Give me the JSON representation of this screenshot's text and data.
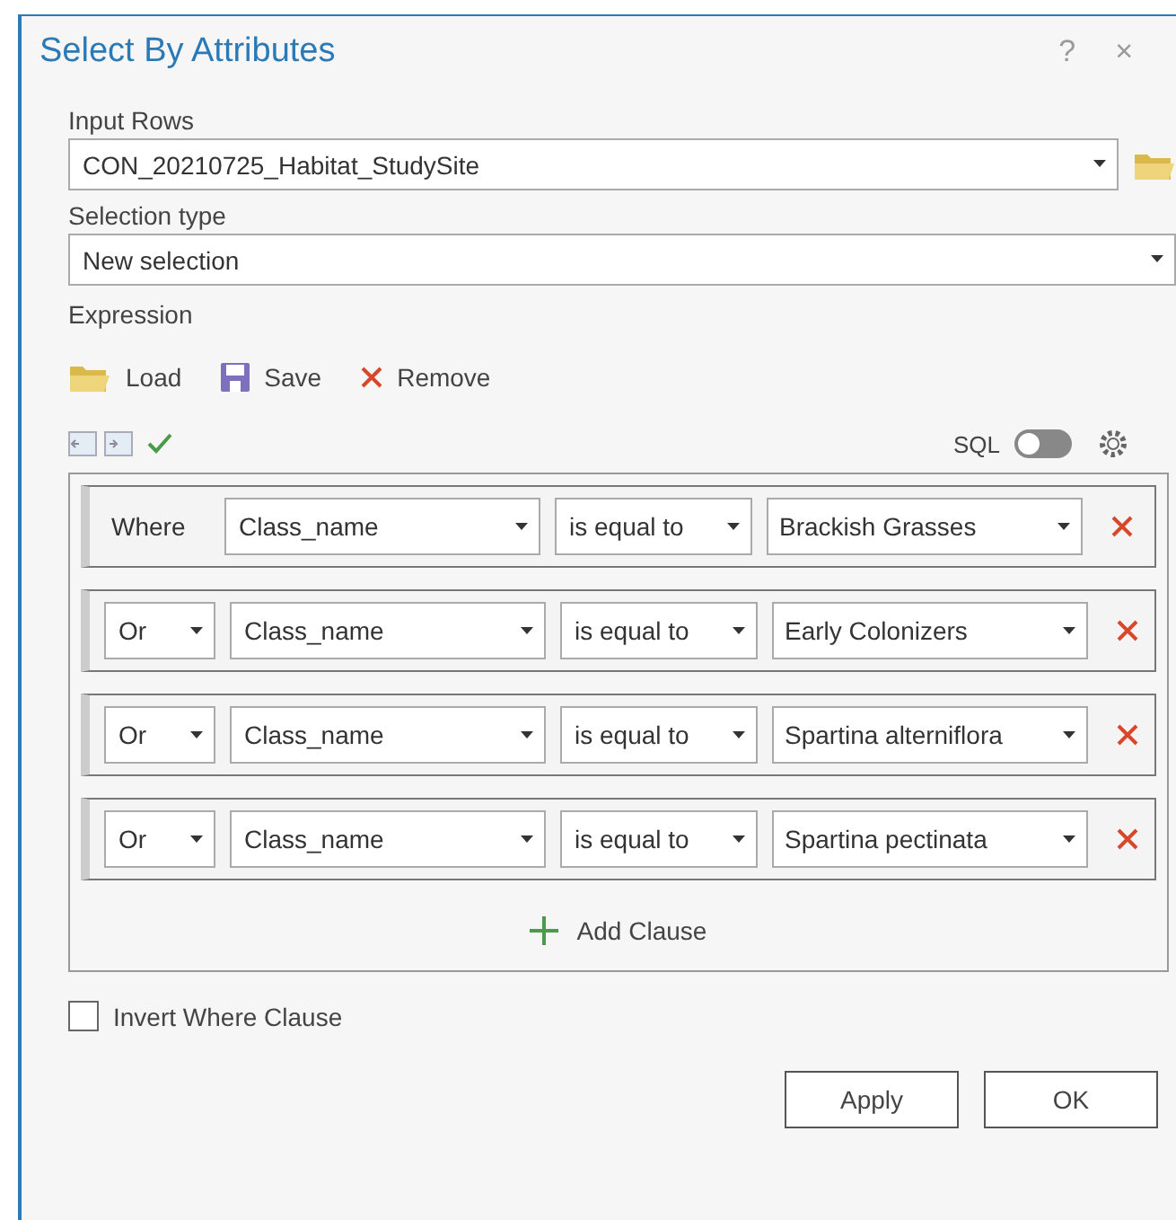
{
  "window": {
    "title": "Select By Attributes",
    "help": "?",
    "close": "×"
  },
  "input_rows": {
    "label": "Input Rows",
    "value": "CON_20210725_Habitat_StudySite"
  },
  "selection_type": {
    "label": "Selection type",
    "value": "New selection"
  },
  "expression": {
    "label": "Expression",
    "toolbar": [
      {
        "kind": "load",
        "label": "Load"
      },
      {
        "kind": "save",
        "label": "Save"
      },
      {
        "kind": "remove",
        "label": "Remove"
      }
    ],
    "sql": {
      "label": "SQL",
      "on": false
    }
  },
  "clauses": [
    {
      "kind": "where",
      "connector": "Where",
      "field": "Class_name",
      "operator": "is equal to",
      "value": "Brackish Grasses"
    },
    {
      "kind": "connector",
      "connector": "Or",
      "field": "Class_name",
      "operator": "is equal to",
      "value": "Early Colonizers"
    },
    {
      "kind": "connector",
      "connector": "Or",
      "field": "Class_name",
      "operator": "is equal to",
      "value": "Spartina alterniflora"
    },
    {
      "kind": "connector",
      "connector": "Or",
      "field": "Class_name",
      "operator": "is equal to",
      "value": "Spartina pectinata"
    }
  ],
  "add_clause": "Add Clause",
  "invert": {
    "label": "Invert Where Clause",
    "checked": false
  },
  "buttons": [
    "Apply",
    "OK"
  ]
}
